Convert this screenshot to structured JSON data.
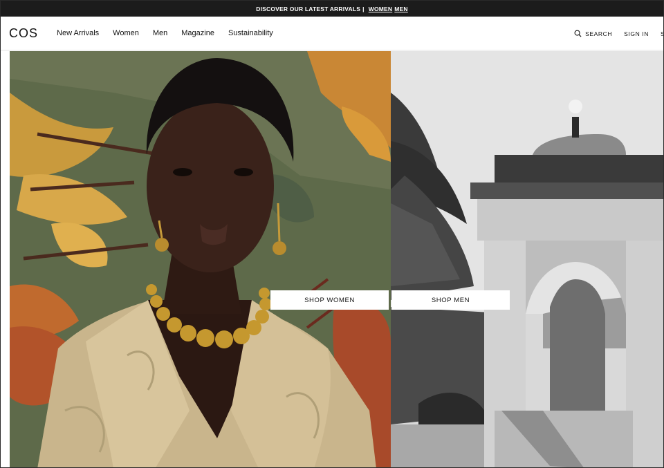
{
  "promo": {
    "text": "DISCOVER OUR LATEST ARRIVALS",
    "separator": "|",
    "link_women": "WOMEN",
    "link_men": "MEN"
  },
  "header": {
    "logo": "COS",
    "nav": [
      {
        "label": "New Arrivals"
      },
      {
        "label": "Women"
      },
      {
        "label": "Men"
      },
      {
        "label": "Magazine"
      },
      {
        "label": "Sustainability"
      }
    ],
    "utility": {
      "search_label": "SEARCH",
      "sign_in_label": "SIGN IN",
      "cut_label": "S"
    }
  },
  "hero": {
    "shop_women_label": "SHOP WOMEN",
    "shop_men_label": "SHOP MEN"
  },
  "colors": {
    "promo_bg": "#1c1c1c",
    "header_bg": "#ffffff",
    "text": "#111111"
  }
}
